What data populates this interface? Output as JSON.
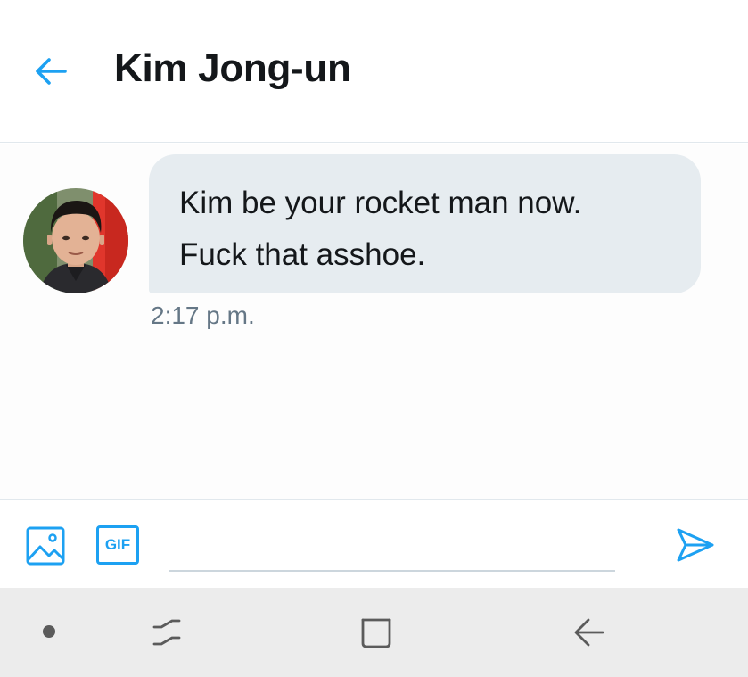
{
  "header": {
    "back_icon": "arrow-left-icon",
    "title": "Kim Jong-un"
  },
  "conversation": {
    "messages": [
      {
        "lines": [
          "Kim be your rocket man now.",
          "Fuck that asshoe."
        ],
        "time": "2:17 p.m.",
        "avatar": "avatar-photo"
      }
    ]
  },
  "composer": {
    "media_icon": "image-icon",
    "gif_label": "GIF",
    "input_value": "",
    "input_placeholder": "",
    "send_icon": "send-icon"
  },
  "system_nav": {
    "items": [
      "dot-icon",
      "recent-apps-icon",
      "home-icon",
      "back-icon"
    ]
  },
  "colors": {
    "accent": "#1da1f2",
    "bubble": "#e6ecf0",
    "text": "#14171a",
    "secondary_text": "#657786",
    "nav_bar": "#ececec"
  }
}
